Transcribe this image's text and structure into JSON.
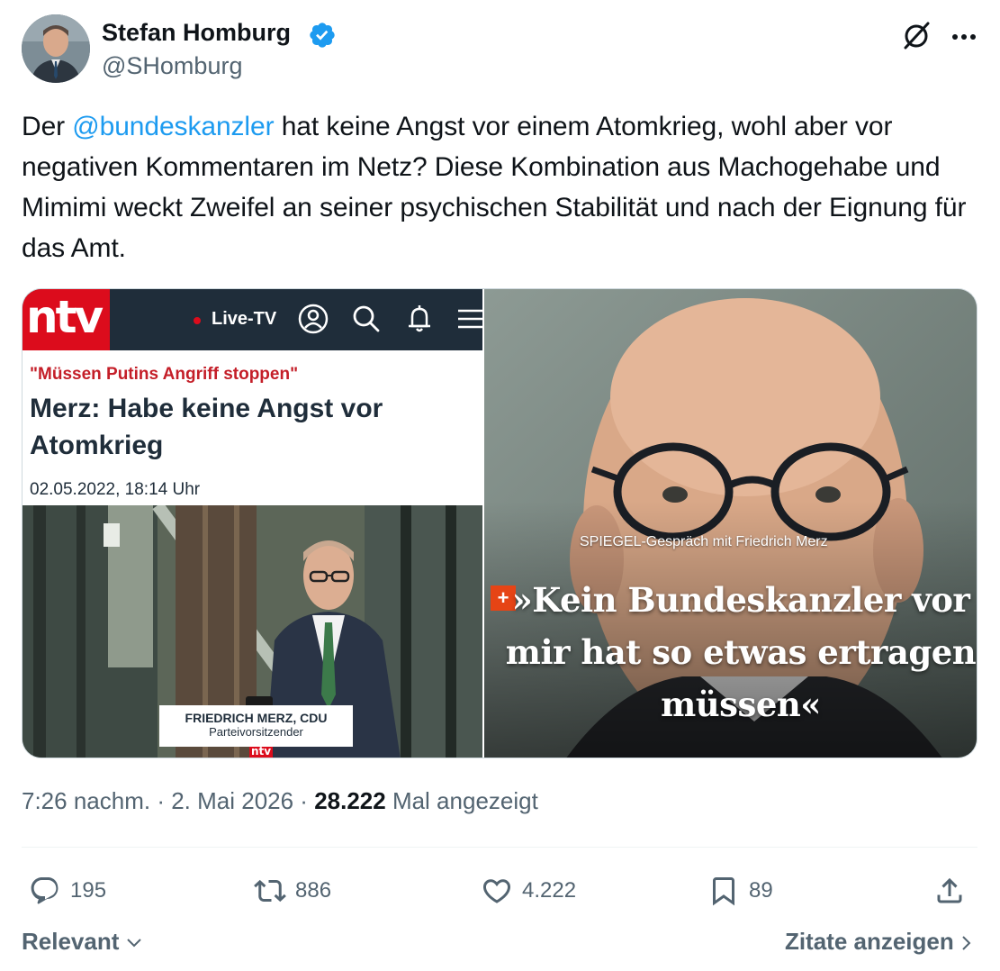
{
  "author": {
    "name": "Stefan Homburg",
    "handle": "@SHomburg",
    "verified": true
  },
  "tweet": {
    "text_before": "Der ",
    "mention": "@bundeskanzler",
    "text_after": " hat keine Angst vor einem Atomkrieg, wohl aber vor negativen Kommentaren im Netz? Diese Kombination aus Machogehabe und Mimimi weckt Zweifel an seiner psychischen Stabilität und nach der Eignung für das Amt."
  },
  "media_left": {
    "logo": "ntv",
    "live_label": "Live-TV",
    "kicker": "\"Müssen Putins Angriff stoppen\"",
    "headline": "Merz: Habe keine Angst vor Atomkrieg",
    "date": "02.05.2022, 18:14 Uhr",
    "lower_third_name": "FRIEDRICH MERZ, CDU",
    "lower_third_role": "Parteivorsitzender",
    "mic_logo": "ntv"
  },
  "media_right": {
    "caption": "SPIEGEL-Gespräch mit Friedrich Merz",
    "plus": "+",
    "quote": "»Kein Bundeskanzler vor mir hat so etwas ertragen müssen«"
  },
  "meta": {
    "time": "7:26 nachm.",
    "sep1": " · ",
    "date": "2. Mai 2026",
    "sep2": " · ",
    "views": "28.222",
    "views_label": " Mal angezeigt"
  },
  "actions": {
    "replies": "195",
    "reposts": "886",
    "likes": "4.222",
    "bookmarks": "89"
  },
  "footer": {
    "sort_label": "Relevant",
    "quotes_label": "Zitate anzeigen"
  },
  "colors": {
    "link": "#1d9bf0",
    "verified": "#1d9bf0",
    "secondary_text": "#536471",
    "ntv_red": "#dc0c1c",
    "ntv_navy": "#1f2d3a"
  }
}
